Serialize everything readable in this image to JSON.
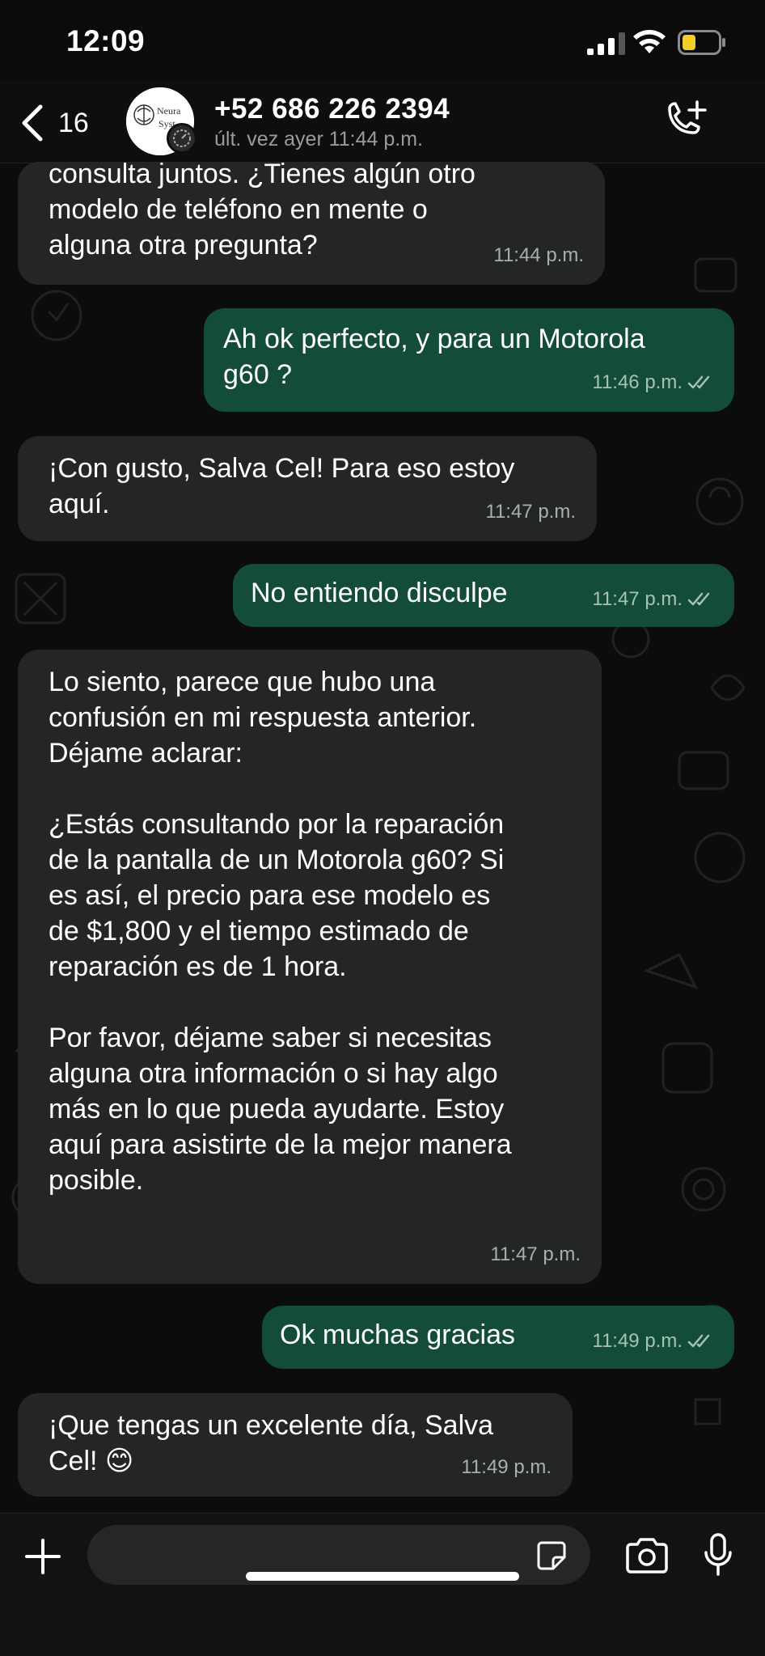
{
  "status_bar": {
    "time": "12:09",
    "battery_color": "#f2d027"
  },
  "header": {
    "back_count": "16",
    "contact_name": "+52 686 226 2394",
    "last_seen": "últ. vez ayer 11:44 p.m.",
    "avatar_text_1": "Neura",
    "avatar_text_2": "Syst"
  },
  "colors": {
    "incoming": "#242626",
    "outgoing": "#144d37",
    "background": "#0c0c0c"
  },
  "messages": [
    {
      "direction": "in",
      "text": "consulta juntos. ¿Tienes algún otro\nmodelo de teléfono en mente o\nalguna otra pregunta?",
      "time": "11:44 p.m."
    },
    {
      "direction": "out",
      "text": "Ah ok perfecto, y para un Motorola\ng60 ?",
      "time": "11:46 p.m.",
      "status": "read"
    },
    {
      "direction": "in",
      "text": "¡Con gusto, Salva Cel! Para eso estoy\naquí.",
      "time": "11:47 p.m."
    },
    {
      "direction": "out",
      "text": "No entiendo disculpe",
      "time": "11:47 p.m.",
      "status": "read"
    },
    {
      "direction": "in",
      "text": "Lo siento, parece que hubo una\nconfusión en mi respuesta anterior.\nDéjame aclarar:\n\n¿Estás consultando por la reparación\nde la pantalla de un Motorola g60? Si\nes así, el precio para ese modelo es\nde $1,800 y el tiempo estimado de\nreparación es de 1 hora.\n\nPor favor, déjame saber si necesitas\nalguna otra información o si hay algo\nmás en lo que pueda ayudarte. Estoy\naquí para asistirte de la mejor manera\nposible.",
      "time": "11:47 p.m."
    },
    {
      "direction": "out",
      "text": "Ok muchas gracias",
      "time": "11:49 p.m.",
      "status": "read"
    },
    {
      "direction": "in",
      "text": "¡Que tengas un excelente día, Salva\nCel! 😊",
      "time": "11:49 p.m."
    }
  ],
  "input": {
    "placeholder": "",
    "value": ""
  },
  "icons": {
    "back": "chevron-left-icon",
    "call": "add-call-icon",
    "plus": "plus-icon",
    "sticker": "sticker-icon",
    "camera": "camera-icon",
    "mic": "microphone-icon",
    "ticks": "double-check-icon"
  }
}
